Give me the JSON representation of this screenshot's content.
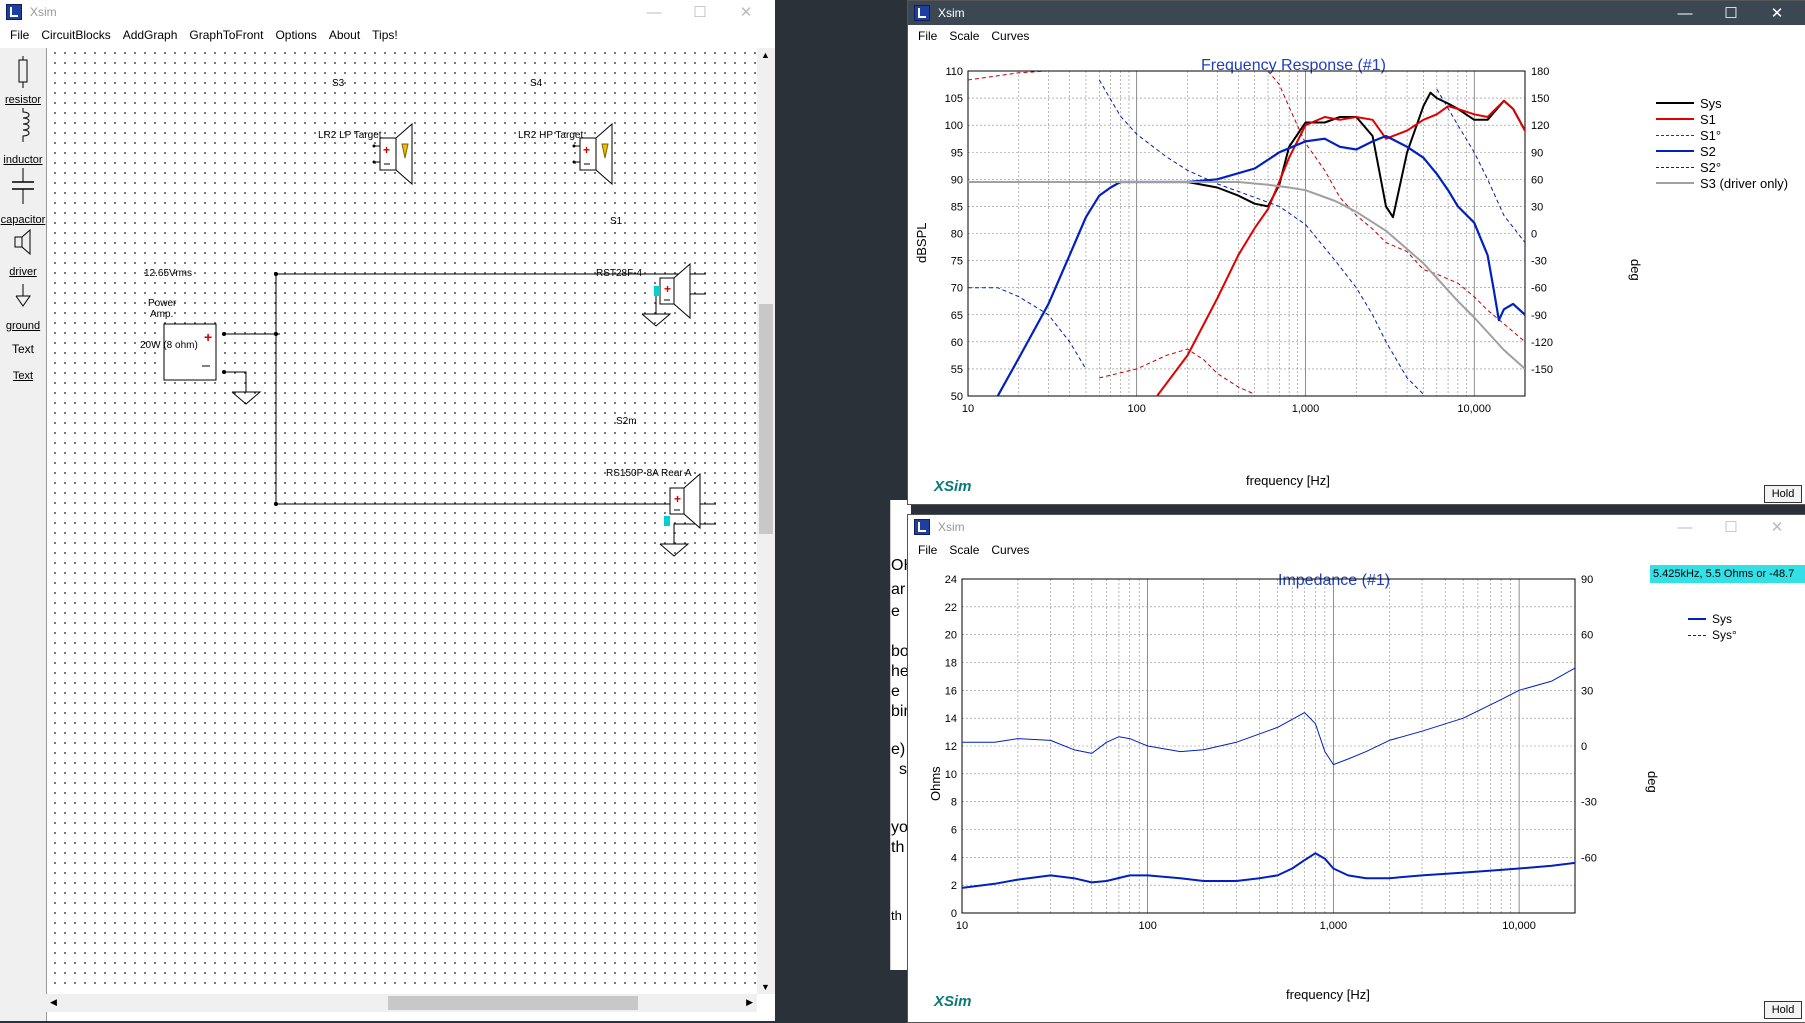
{
  "main_window": {
    "title": "Xsim",
    "controls": [
      "—",
      "☐",
      "✕"
    ],
    "menu": [
      "File",
      "CircuitBlocks",
      "AddGraph",
      "GraphToFront",
      "Options",
      "About",
      "Tips!"
    ],
    "toolbar": [
      {
        "label": "resistor",
        "icon": "resistor-icon"
      },
      {
        "label": "inductor",
        "icon": "inductor-icon"
      },
      {
        "label": "capacitor",
        "icon": "capacitor-icon"
      },
      {
        "label": "driver",
        "icon": "driver-icon"
      },
      {
        "label": "ground",
        "icon": "ground-icon"
      },
      {
        "label": "Text",
        "icon": "text-icon"
      },
      {
        "label": "Text",
        "icon": "text-link"
      }
    ],
    "schematic": {
      "s3": {
        "name": "S3",
        "desc": "LR2 LP Target"
      },
      "s4": {
        "name": "S4",
        "desc": "LR2 HP Target"
      },
      "s1": {
        "name": "S1",
        "desc": "RST28F-4"
      },
      "s2m": {
        "name": "S2m",
        "desc": "RS150P-8A Rear A"
      },
      "amp": {
        "voltage": "12.65Vrms",
        "label1": "Power",
        "label2": "Amp.",
        "power": "20W (8 ohm)"
      }
    }
  },
  "fr_window": {
    "title": "Xsim",
    "menu": [
      "File",
      "Scale",
      "Curves"
    ],
    "chart_title": "Frequency Response (#1)",
    "logo": "XSim",
    "hold": "Hold",
    "xlabel": "frequency [Hz]",
    "ylabel": "dBSPL",
    "y2label": "deg",
    "legend": [
      {
        "name": "Sys",
        "color": "#000000",
        "dash": false
      },
      {
        "name": "S1",
        "color": "#e00000",
        "dash": false
      },
      {
        "name": "S1°",
        "color": "#c00000",
        "dash": true
      },
      {
        "name": "S2",
        "color": "#0020c0",
        "dash": false
      },
      {
        "name": "S2°",
        "color": "#0020a0",
        "dash": true
      },
      {
        "name": "S3 (driver only)",
        "color": "#a0a0a0",
        "dash": false
      }
    ]
  },
  "imp_window": {
    "title": "Xsim",
    "menu": [
      "File",
      "Scale",
      "Curves"
    ],
    "chart_title": "Impedance (#1)",
    "logo": "XSim",
    "hold": "Hold",
    "readout": "5.425kHz, 5.5 Ohms or -48.7",
    "xlabel": "frequency [Hz]",
    "ylabel": "Ohms",
    "y2label": "deg",
    "legend": [
      {
        "name": "Sys",
        "color": "#0020c0",
        "dash": false
      },
      {
        "name": "Sys°",
        "color": "#0020a0",
        "dash": true
      }
    ]
  },
  "bg_fragments": [
    "OH",
    "ar",
    "e",
    "bo",
    "he",
    "e",
    "bin",
    "e)",
    "s",
    "yo",
    "th",
    "th"
  ],
  "chart_data": [
    {
      "type": "line",
      "title": "Frequency Response (#1)",
      "xlabel": "frequency [Hz]",
      "ylabel": "dBSPL",
      "y2label": "deg",
      "xscale": "log",
      "xlim": [
        10,
        20000
      ],
      "ylim": [
        50,
        110
      ],
      "y2lim": [
        -180,
        180
      ],
      "x_ticks": [
        "10",
        "100",
        "1,000",
        "10,000"
      ],
      "y_ticks": [
        50,
        55,
        60,
        65,
        70,
        75,
        80,
        85,
        90,
        95,
        100,
        105,
        110
      ],
      "y2_ticks": [
        -150,
        -120,
        -90,
        -60,
        -30,
        0,
        30,
        60,
        90,
        120,
        150,
        180
      ],
      "series": [
        {
          "name": "Sys",
          "axis": "left",
          "x": [
            10,
            20,
            50,
            100,
            200,
            300,
            400,
            500,
            600,
            700,
            800,
            1000,
            1300,
            1600,
            2000,
            2500,
            3000,
            3300,
            4000,
            5000,
            5500,
            6000,
            7000,
            8000,
            10000,
            12000,
            15000,
            17000,
            20000
          ],
          "y": [
            89.5,
            89.5,
            89.5,
            89.5,
            89.5,
            88.5,
            87,
            85.5,
            85,
            89,
            96,
            100.5,
            100.5,
            101.5,
            101.5,
            98,
            85,
            83,
            95,
            103.5,
            106,
            105,
            104,
            103,
            101,
            101,
            104.5,
            103,
            99
          ]
        },
        {
          "name": "S1",
          "axis": "left",
          "x": [
            10,
            100,
            200,
            300,
            400,
            500,
            600,
            800,
            1000,
            1300,
            1600,
            2000,
            2500,
            3000,
            4000,
            5000,
            6000,
            7000,
            8000,
            10000,
            12000,
            15000,
            17000,
            20000
          ],
          "y": [
            40,
            45,
            57.5,
            68,
            76,
            81,
            84.5,
            94,
            100,
            101.5,
            101,
            101.5,
            101,
            97.5,
            99,
            101,
            102,
            103.5,
            103,
            102,
            101.5,
            104.5,
            103,
            99
          ]
        },
        {
          "name": "S1°",
          "axis": "right",
          "x": [
            10,
            20,
            30,
            60,
            100,
            150,
            200,
            250,
            300,
            400,
            500,
            600,
            700,
            800,
            1000,
            1300,
            1600,
            2000,
            2500,
            3000,
            4000,
            5000,
            6000,
            8000,
            10000,
            12000,
            15000,
            20000
          ],
          "y": [
            170,
            178,
            180,
            -160,
            -150,
            -135,
            -128,
            -140,
            -155,
            -170,
            -178,
            180,
            165,
            140,
            100,
            70,
            40,
            20,
            5,
            -10,
            -20,
            -40,
            -45,
            -55,
            -70,
            -85,
            -100,
            -120
          ]
        },
        {
          "name": "S2",
          "axis": "left",
          "x": [
            10,
            15,
            20,
            30,
            40,
            50,
            60,
            70,
            80,
            100,
            150,
            200,
            300,
            500,
            700,
            1000,
            1300,
            1600,
            2000,
            2500,
            3000,
            4000,
            5000,
            6000,
            7000,
            8000,
            10000,
            12000,
            13000,
            14000,
            15000,
            17000,
            20000
          ],
          "y": [
            43,
            50,
            57,
            67,
            76,
            83,
            87,
            88.5,
            89.5,
            89.5,
            89.5,
            89.5,
            90,
            92,
            95,
            97,
            97.5,
            96,
            95.5,
            97,
            98,
            96,
            94,
            91,
            88,
            85,
            82,
            76,
            70,
            64,
            66,
            67,
            65
          ]
        },
        {
          "name": "S2°",
          "axis": "right",
          "x": [
            10,
            15,
            20,
            30,
            40,
            50,
            60,
            80,
            100,
            150,
            200,
            300,
            500,
            700,
            1000,
            1500,
            2000,
            2500,
            3000,
            4000,
            5000,
            6000,
            8000,
            10000,
            12000,
            15000,
            20000
          ],
          "y": [
            -60,
            -60,
            -70,
            -90,
            -120,
            -150,
            170,
            130,
            110,
            85,
            70,
            55,
            40,
            30,
            10,
            -30,
            -60,
            -90,
            -120,
            -160,
            -178,
            160,
            120,
            90,
            60,
            20,
            -10
          ]
        },
        {
          "name": "S3 (driver only)",
          "axis": "left",
          "x": [
            10,
            100,
            200,
            400,
            600,
            800,
            1000,
            1500,
            2000,
            3000,
            5000,
            8000,
            10000,
            15000,
            20000
          ],
          "y": [
            89.5,
            89.5,
            89.5,
            89.5,
            89,
            88.5,
            88,
            86,
            84,
            80.5,
            74.5,
            67.5,
            64.5,
            58.5,
            55
          ]
        }
      ]
    },
    {
      "type": "line",
      "title": "Impedance (#1)",
      "xlabel": "frequency [Hz]",
      "ylabel": "Ohms",
      "y2label": "deg",
      "xscale": "log",
      "xlim": [
        10,
        20000
      ],
      "ylim": [
        0,
        24
      ],
      "y2lim": [
        -90,
        90
      ],
      "x_ticks": [
        "10",
        "100",
        "1,000",
        "10,000"
      ],
      "y_ticks": [
        0,
        2,
        4,
        6,
        8,
        10,
        12,
        14,
        16,
        18,
        20,
        22,
        24
      ],
      "y2_ticks": [
        -60,
        -30,
        0,
        30,
        60,
        90
      ],
      "series": [
        {
          "name": "Sys",
          "axis": "left",
          "x": [
            10,
            15,
            20,
            30,
            40,
            50,
            60,
            80,
            100,
            150,
            200,
            300,
            400,
            500,
            600,
            700,
            800,
            900,
            1000,
            1200,
            1500,
            2000,
            3000,
            5000,
            8000,
            10000,
            15000,
            20000
          ],
          "y": [
            1.8,
            2.1,
            2.4,
            2.7,
            2.5,
            2.2,
            2.3,
            2.7,
            2.7,
            2.5,
            2.3,
            2.3,
            2.5,
            2.7,
            3.2,
            3.8,
            4.3,
            3.9,
            3.2,
            2.7,
            2.5,
            2.5,
            2.7,
            2.9,
            3.1,
            3.2,
            3.4,
            3.6
          ]
        },
        {
          "name": "Sys°",
          "axis": "right",
          "x": [
            10,
            15,
            20,
            30,
            40,
            50,
            60,
            70,
            80,
            100,
            150,
            200,
            300,
            500,
            700,
            800,
            900,
            1000,
            1200,
            1500,
            2000,
            3000,
            5000,
            8000,
            10000,
            15000,
            20000
          ],
          "y": [
            2,
            2,
            4,
            3,
            -2,
            -4,
            2,
            5,
            4,
            0,
            -3,
            -2,
            2,
            10,
            18,
            12,
            -3,
            -10,
            -7,
            -3,
            3,
            8,
            15,
            25,
            30,
            35,
            42
          ]
        }
      ]
    }
  ]
}
